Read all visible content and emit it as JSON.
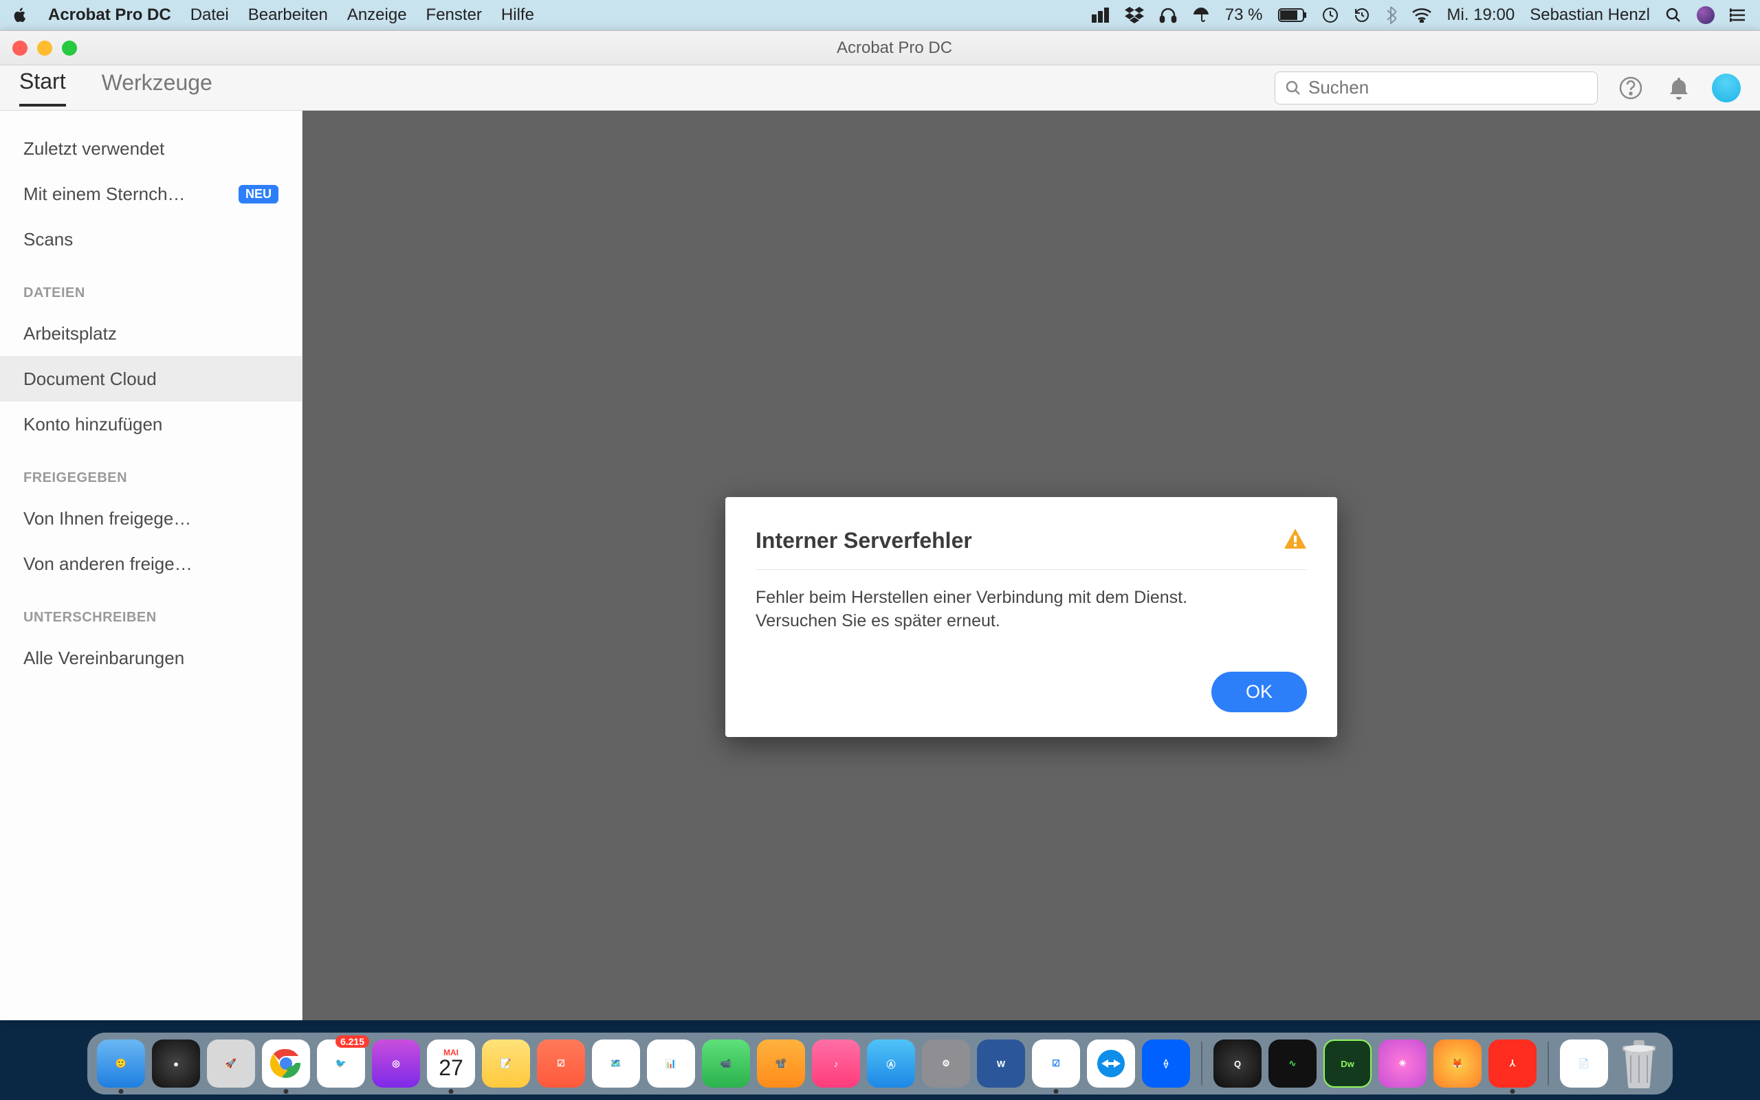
{
  "menubar": {
    "app_name": "Acrobat Pro DC",
    "items": [
      "Datei",
      "Bearbeiten",
      "Anzeige",
      "Fenster",
      "Hilfe"
    ],
    "battery": "73 %",
    "datetime": "Mi. 19:00",
    "username": "Sebastian Henzl"
  },
  "window": {
    "title": "Acrobat Pro DC",
    "tabs": {
      "start": "Start",
      "tools": "Werkzeuge"
    },
    "search_placeholder": "Suchen"
  },
  "sidebar": {
    "items_top": [
      {
        "label": "Zuletzt verwendet"
      },
      {
        "label": "Mit einem Sternch…",
        "badge": "NEU"
      },
      {
        "label": "Scans"
      }
    ],
    "group_files": "DATEIEN",
    "items_files": [
      {
        "label": "Arbeitsplatz"
      },
      {
        "label": "Document Cloud",
        "selected": true
      },
      {
        "label": "Konto hinzufügen"
      }
    ],
    "group_shared": "FREIGEGEBEN",
    "items_shared": [
      {
        "label": "Von Ihnen freigege…"
      },
      {
        "label": "Von anderen freige…"
      }
    ],
    "group_sign": "UNTERSCHREIBEN",
    "items_sign": [
      {
        "label": "Alle Vereinbarungen"
      }
    ]
  },
  "dialog": {
    "title": "Interner Serverfehler",
    "message_l1": "Fehler beim Herstellen einer Verbindung mit dem Dienst.",
    "message_l2": "Versuchen Sie es später erneut.",
    "ok": "OK"
  },
  "dock": {
    "mail_badge": "6.215",
    "cal_month": "MAI",
    "cal_day": "27"
  }
}
